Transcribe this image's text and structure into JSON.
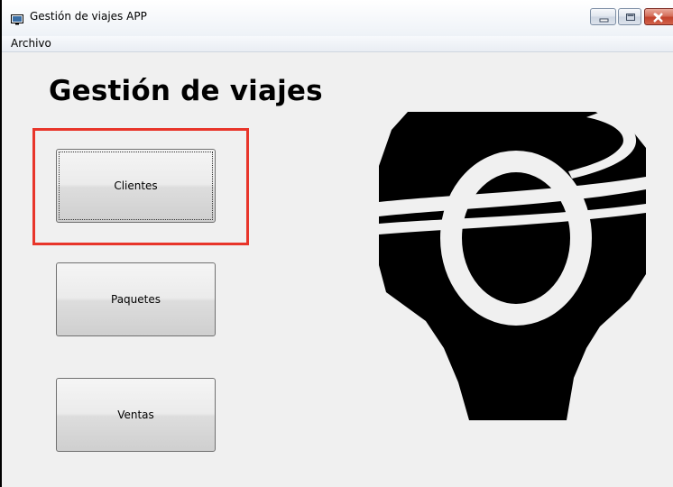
{
  "window": {
    "title": "Gestión de viajes APP",
    "controls": [
      "minimize",
      "maximize",
      "close"
    ]
  },
  "menu": {
    "items": [
      {
        "label": "Archivo"
      }
    ]
  },
  "main": {
    "heading": "Gestión de viajes",
    "buttons": [
      {
        "label": "Clientes",
        "focused": true,
        "highlighted": true
      },
      {
        "label": "Paquetes"
      },
      {
        "label": "Ventas"
      }
    ],
    "logo_icon": "travel-logo-icon"
  },
  "colors": {
    "highlight": "#e8352a",
    "background": "#f0f0f0",
    "logo": "#000000"
  }
}
